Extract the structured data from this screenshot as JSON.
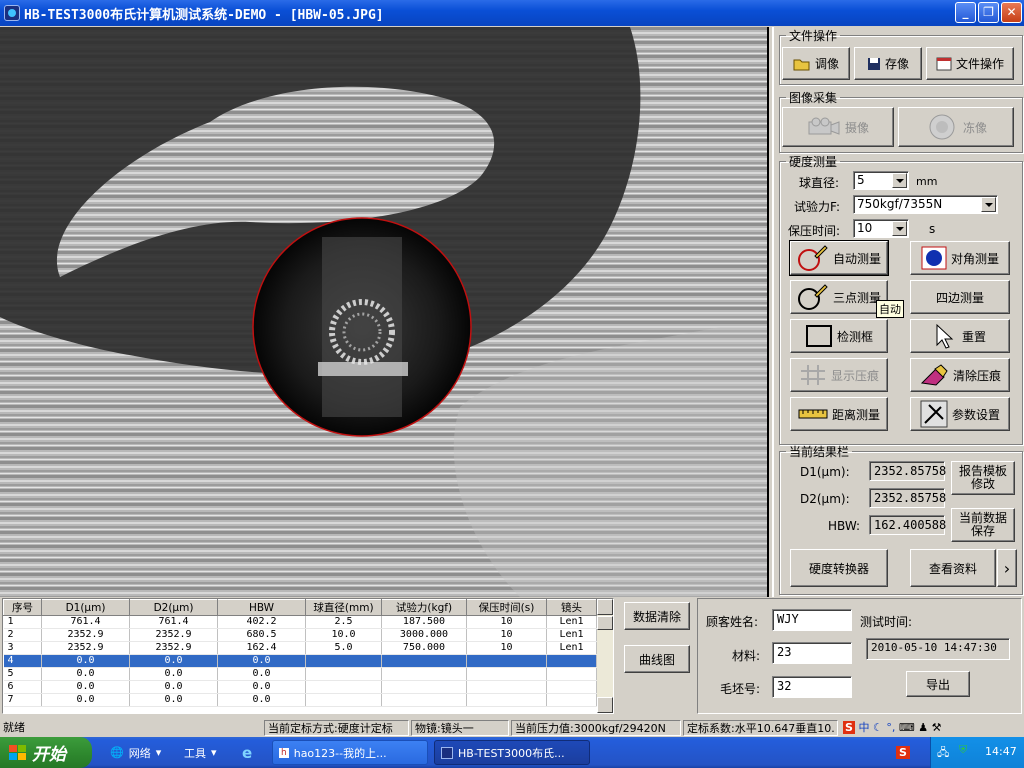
{
  "window": {
    "title": "HB-TEST3000布氏计算机测试系统-DEMO - [HBW-05.JPG]"
  },
  "file_ops": {
    "legend": "文件操作",
    "open_label": "调像",
    "save_label": "存像",
    "fileop_label": "文件操作"
  },
  "capture": {
    "legend": "图像采集",
    "camera_label": "摄像",
    "freeze_label": "冻像"
  },
  "hardness": {
    "legend": "硬度测量",
    "ball_label": "球直径:",
    "ball_value": "5",
    "ball_unit": "mm",
    "force_label": "试验力F:",
    "force_value": "750kgf/7355N",
    "dwell_label": "保压时间:",
    "dwell_value": "10",
    "dwell_unit": "s",
    "auto_label": "自动测量",
    "diag_label": "对角测量",
    "three_label": "三点测量",
    "four_label": "四边测量",
    "box_label": "检测框",
    "reset_label": "重置",
    "show_label": "显示压痕",
    "clear_label": "清除压痕",
    "dist_label": "距离测量",
    "param_label": "参数设置",
    "tooltip": "自动"
  },
  "results": {
    "legend": "当前结果栏",
    "d1_label": "D1(μm):",
    "d1_value": "2352.85758",
    "d2_label": "D2(μm):",
    "d2_value": "2352.85758",
    "hbw_label": "HBW:",
    "hbw_value": "162.400588",
    "template_label_1": "报告模板",
    "template_label_2": "修改",
    "savedata_label_1": "当前数据",
    "savedata_label_2": "保存",
    "converter_label": "硬度转换器",
    "docs_label": "查看资料",
    "more_label": "›"
  },
  "table": {
    "headers": [
      "序号",
      "D1(μm)",
      "D2(μm)",
      "HBW",
      "球直径(mm)",
      "试验力(kgf)",
      "保压时间(s)",
      "镜头"
    ],
    "rows": [
      [
        "1",
        "761.4",
        "761.4",
        "402.2",
        "2.5",
        "187.500",
        "10",
        "Len1"
      ],
      [
        "2",
        "2352.9",
        "2352.9",
        "680.5",
        "10.0",
        "3000.000",
        "10",
        "Len1"
      ],
      [
        "3",
        "2352.9",
        "2352.9",
        "162.4",
        "5.0",
        "750.000",
        "10",
        "Len1"
      ],
      [
        "4",
        "0.0",
        "0.0",
        "0.0",
        "",
        "",
        "",
        ""
      ],
      [
        "5",
        "0.0",
        "0.0",
        "0.0",
        "",
        "",
        "",
        ""
      ],
      [
        "6",
        "0.0",
        "0.0",
        "0.0",
        "",
        "",
        "",
        ""
      ],
      [
        "7",
        "0.0",
        "0.0",
        "0.0",
        "",
        "",
        "",
        ""
      ]
    ],
    "selected_row": 3
  },
  "data_buttons": {
    "clear_label": "数据清除",
    "curve_label": "曲线图"
  },
  "customer": {
    "name_label": "顾客姓名:",
    "name_value": "WJY",
    "material_label": "材料:",
    "material_value": "23",
    "blank_label": "毛坯号:",
    "blank_value": "32",
    "time_label": "测试时间:",
    "time_value": "2010-05-10 14:47:30",
    "export_label": "导出"
  },
  "status": {
    "ready": "就绪",
    "calib_mode": "当前定标方式:硬度计定标",
    "lens": "物镜:镜头一",
    "pressure": "当前压力值:3000kgf/29420N",
    "coef": "定标系数:水平10.647垂直10."
  },
  "taskbar": {
    "start_label": "开始",
    "network_label": "网络",
    "tools_label": "工具",
    "task1_label": "hao123--我的上...",
    "task2_label": "HB-TEST3000布氏...",
    "clock": "14:47"
  }
}
